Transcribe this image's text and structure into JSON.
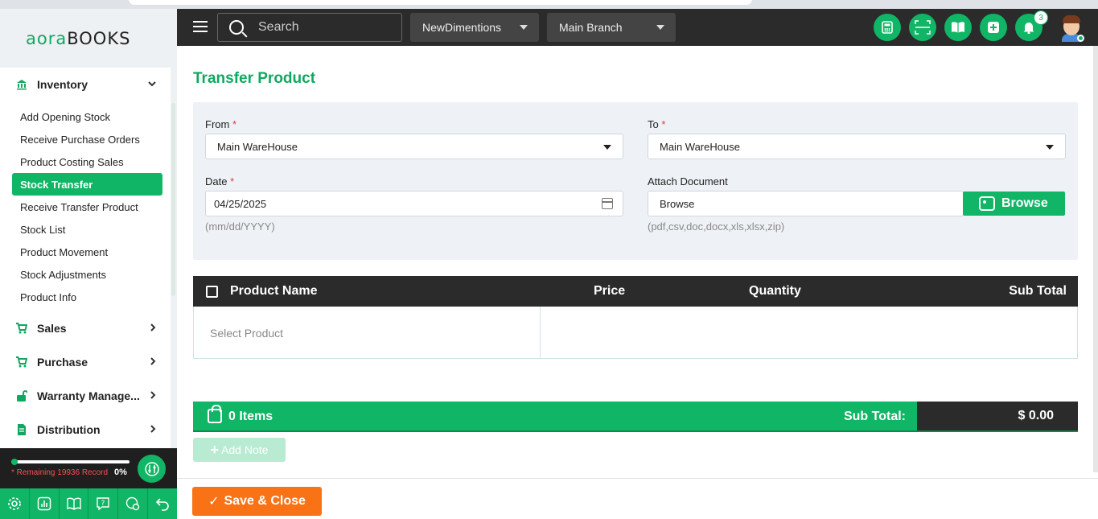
{
  "brand": {
    "logo_part1": "aora",
    "logo_part2": "BOOKS"
  },
  "topbar": {
    "search_placeholder": "Search",
    "company": "NewDimentions",
    "branch": "Main Branch",
    "notification_count": "3"
  },
  "sidebar": {
    "inventory_label": "Inventory",
    "inventory_items": [
      "Add Opening Stock",
      "Receive Purchase Orders",
      "Product Costing Sales",
      "Stock Transfer",
      "Receive Transfer Product",
      "Stock List",
      "Product Movement",
      "Stock Adjustments",
      "Product Info"
    ],
    "groups": [
      "Sales",
      "Purchase",
      "Warranty Manage...",
      "Distribution"
    ],
    "usage_text": "* Remaining 19936 Record",
    "usage_percent": "0%",
    "usage_progress": 0
  },
  "page": {
    "title": "Transfer Product",
    "from_label": "From",
    "from_value": "Main WareHouse",
    "to_label": "To",
    "to_value": "Main WareHouse",
    "date_label": "Date",
    "date_value": "04/25/2025",
    "date_hint": "(mm/dd/YYYY)",
    "attach_label": "Attach Document",
    "attach_value": "Browse",
    "attach_button": "Browse",
    "attach_hint": "(pdf,csv,doc,docx,xls,xlsx,zip)",
    "required_mark": "*"
  },
  "table": {
    "columns": [
      "Product Name",
      "Price",
      "Quantity",
      "Sub Total"
    ],
    "select_placeholder": "Select Product"
  },
  "summary": {
    "items": "0 Items",
    "subtotal_label": "Sub Total:",
    "subtotal_value": "$ 0.00"
  },
  "actions": {
    "add_note": "Add Note",
    "save_close": "Save & Close"
  },
  "colors": {
    "accent": "#10b565",
    "dark": "#2b2b2b",
    "orange": "#f97316"
  }
}
